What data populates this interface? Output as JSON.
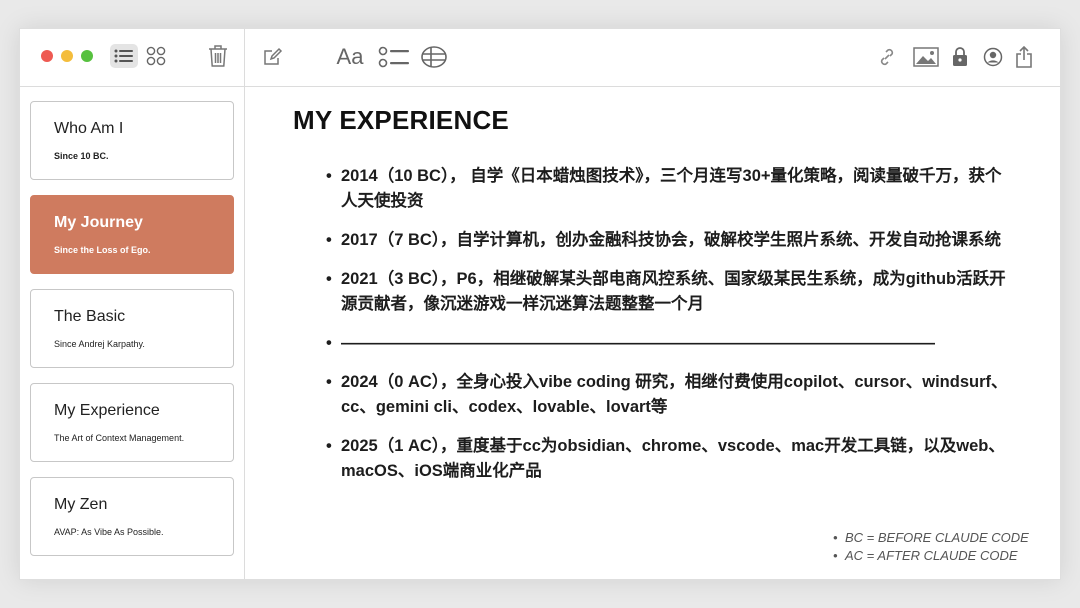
{
  "sidebar": {
    "cards": [
      {
        "title": "Who Am I",
        "subtitle": "Since 10 BC."
      },
      {
        "title": "My Journey",
        "subtitle": "Since the Loss of Ego."
      },
      {
        "title": "The Basic",
        "subtitle": "Since Andrej Karpathy."
      },
      {
        "title": "My Experience",
        "subtitle": "The Art of Context Management."
      },
      {
        "title": "My Zen",
        "subtitle": "AVAP: As Vibe As Possible."
      }
    ]
  },
  "toolbar": {
    "font_button": "Aa"
  },
  "note": {
    "title": "MY EXPERIENCE",
    "bullet": "•",
    "items": [
      "2014（10 BC）， 自学《日本蜡烛图技术》，三个月连写30+量化策略，阅读量破千万，获个人天使投资",
      "2017（7 BC），自学计算机，创办金融科技协会，破解校学生照片系统、开发自动抢课系统",
      "2021（3 BC），P6，相继破解某头部电商风控系统、国家级某民生系统，成为github活跃开源贡献者，像沉迷游戏一样沉迷算法题整整一个月",
      "————————————————————————————————————",
      "2024（0 AC），全身心投入vibe coding 研究，相继付费使用copilot、cursor、windsurf、cc、gemini cli、codex、lovable、lovart等",
      "2025（1 AC），重度基于cc为obsidian、chrome、vscode、mac开发工具链，以及web、macOS、iOS端商业化产品"
    ],
    "legend": [
      "BC = BEFORE CLAUDE CODE",
      "AC = AFTER CLAUDE CODE"
    ]
  },
  "colors": {
    "accent": "#cf7b5f",
    "close": "#ee5a52",
    "minimize": "#f4bd3c",
    "zoom": "#57c13f"
  }
}
